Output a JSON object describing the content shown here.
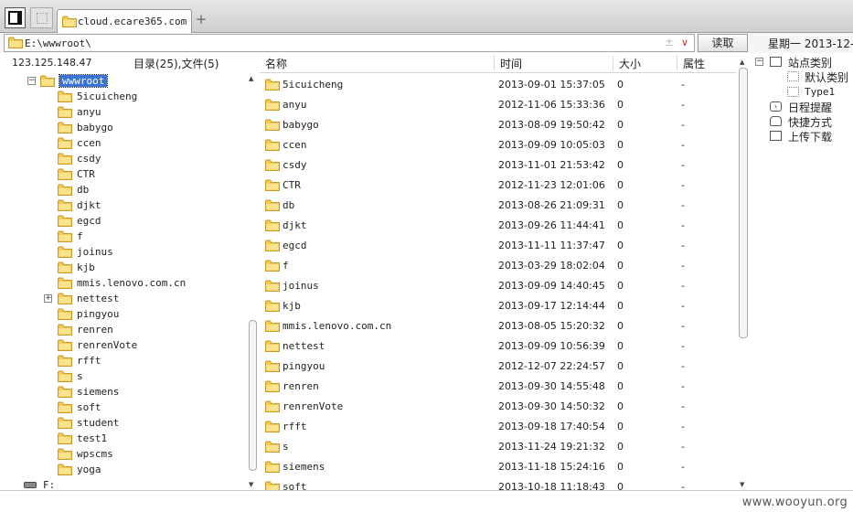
{
  "tab": {
    "label": "cloud.ecare365.com"
  },
  "address": {
    "path": "E:\\wwwroot\\",
    "read_label": "读取",
    "date_label": "星期一  2013-12-0"
  },
  "left": {
    "ip": "123.125.148.47",
    "counts": "目录(25),文件(5)"
  },
  "tree": {
    "root": "wwwroot",
    "children": [
      "5icuicheng",
      "anyu",
      "babygo",
      "ccen",
      "csdy",
      "CTR",
      "db",
      "djkt",
      "egcd",
      "f",
      "joinus",
      "kjb",
      "mmis.lenovo.com.cn",
      "nettest",
      "pingyou",
      "renren",
      "renrenVote",
      "rfft",
      "s",
      "siemens",
      "soft",
      "student",
      "test1",
      "wpscms",
      "yoga"
    ],
    "expandable_child": "nettest",
    "drive": "F:"
  },
  "columns": {
    "name": "名称",
    "time": "时间",
    "size": "大小",
    "attr": "属性"
  },
  "files": [
    {
      "name": "5icuicheng",
      "time": "2013-09-01 15:37:05",
      "size": "0",
      "attr": "-"
    },
    {
      "name": "anyu",
      "time": "2012-11-06 15:33:36",
      "size": "0",
      "attr": "-"
    },
    {
      "name": "babygo",
      "time": "2013-08-09 19:50:42",
      "size": "0",
      "attr": "-"
    },
    {
      "name": "ccen",
      "time": "2013-09-09 10:05:03",
      "size": "0",
      "attr": "-"
    },
    {
      "name": "csdy",
      "time": "2013-11-01 21:53:42",
      "size": "0",
      "attr": "-"
    },
    {
      "name": "CTR",
      "time": "2012-11-23 12:01:06",
      "size": "0",
      "attr": "-"
    },
    {
      "name": "db",
      "time": "2013-08-26 21:09:31",
      "size": "0",
      "attr": "-"
    },
    {
      "name": "djkt",
      "time": "2013-09-26 11:44:41",
      "size": "0",
      "attr": "-"
    },
    {
      "name": "egcd",
      "time": "2013-11-11 11:37:47",
      "size": "0",
      "attr": "-"
    },
    {
      "name": "f",
      "time": "2013-03-29 18:02:04",
      "size": "0",
      "attr": "-"
    },
    {
      "name": "joinus",
      "time": "2013-09-09 14:40:45",
      "size": "0",
      "attr": "-"
    },
    {
      "name": "kjb",
      "time": "2013-09-17 12:14:44",
      "size": "0",
      "attr": "-"
    },
    {
      "name": "mmis.lenovo.com.cn",
      "time": "2013-08-05 15:20:32",
      "size": "0",
      "attr": "-"
    },
    {
      "name": "nettest",
      "time": "2013-09-09 10:56:39",
      "size": "0",
      "attr": "-"
    },
    {
      "name": "pingyou",
      "time": "2012-12-07 22:24:57",
      "size": "0",
      "attr": "-"
    },
    {
      "name": "renren",
      "time": "2013-09-30 14:55:48",
      "size": "0",
      "attr": "-"
    },
    {
      "name": "renrenVote",
      "time": "2013-09-30 14:50:32",
      "size": "0",
      "attr": "-"
    },
    {
      "name": "rfft",
      "time": "2013-09-18 17:40:54",
      "size": "0",
      "attr": "-"
    },
    {
      "name": "s",
      "time": "2013-11-24 19:21:32",
      "size": "0",
      "attr": "-"
    },
    {
      "name": "siemens",
      "time": "2013-11-18 15:24:16",
      "size": "0",
      "attr": "-"
    },
    {
      "name": "soft",
      "time": "2013-10-18 11:18:43",
      "size": "0",
      "attr": "-"
    }
  ],
  "right": {
    "site_category": "站点类别",
    "default_category": "默认类别",
    "type1": "Type1",
    "schedule": "日程提醒",
    "shortcuts": "快捷方式",
    "upload_download": "上传下载"
  },
  "watermark": "www.wooyun.org",
  "icons": [
    "folder-icon",
    "drive-icon",
    "expand-icon",
    "collapse-icon",
    "star-icon",
    "chevron-down-icon",
    "schedule-icon",
    "shortcut-icon",
    "category-icon"
  ],
  "colors": {
    "folder": "#f4cb52",
    "folder_edge": "#c89a2a",
    "selection": "#3a74d6",
    "chevron": "#c62b2b"
  }
}
